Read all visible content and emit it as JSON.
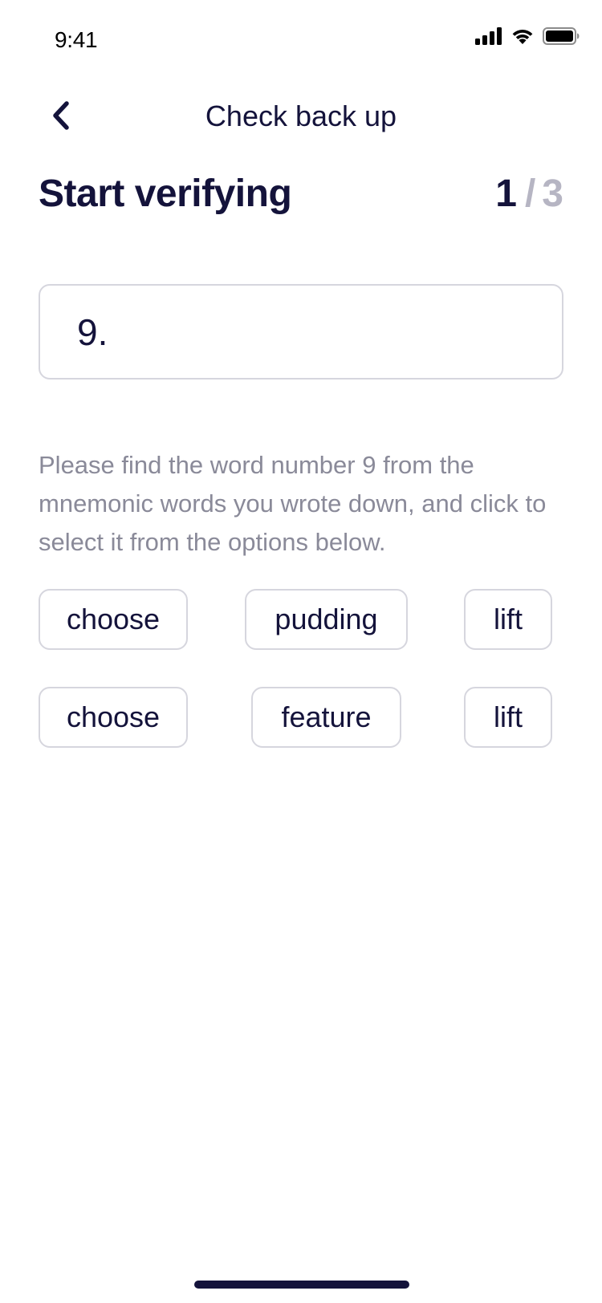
{
  "status_bar": {
    "time": "9:41",
    "icons": [
      "cellular-signal-icon",
      "wifi-icon",
      "battery-icon"
    ]
  },
  "nav": {
    "title": "Check back up",
    "back_icon": "chevron-left-icon"
  },
  "header": {
    "title": "Start verifying",
    "step_current": "1",
    "step_separator": "/",
    "step_total": "3"
  },
  "word_field": {
    "index_label": "9."
  },
  "instructions": "Please find the word number 9 from the mnemonic words you wrote down, and click to select it from the options below.",
  "options": {
    "row1": [
      "choose",
      "pudding",
      "lift"
    ],
    "row2": [
      "choose",
      "feature",
      "lift"
    ]
  },
  "colors": {
    "primary_text": "#14133b",
    "muted_text": "#8a8a99",
    "step_muted": "#b6b5c3",
    "border": "#d6d6de",
    "background": "#ffffff"
  }
}
